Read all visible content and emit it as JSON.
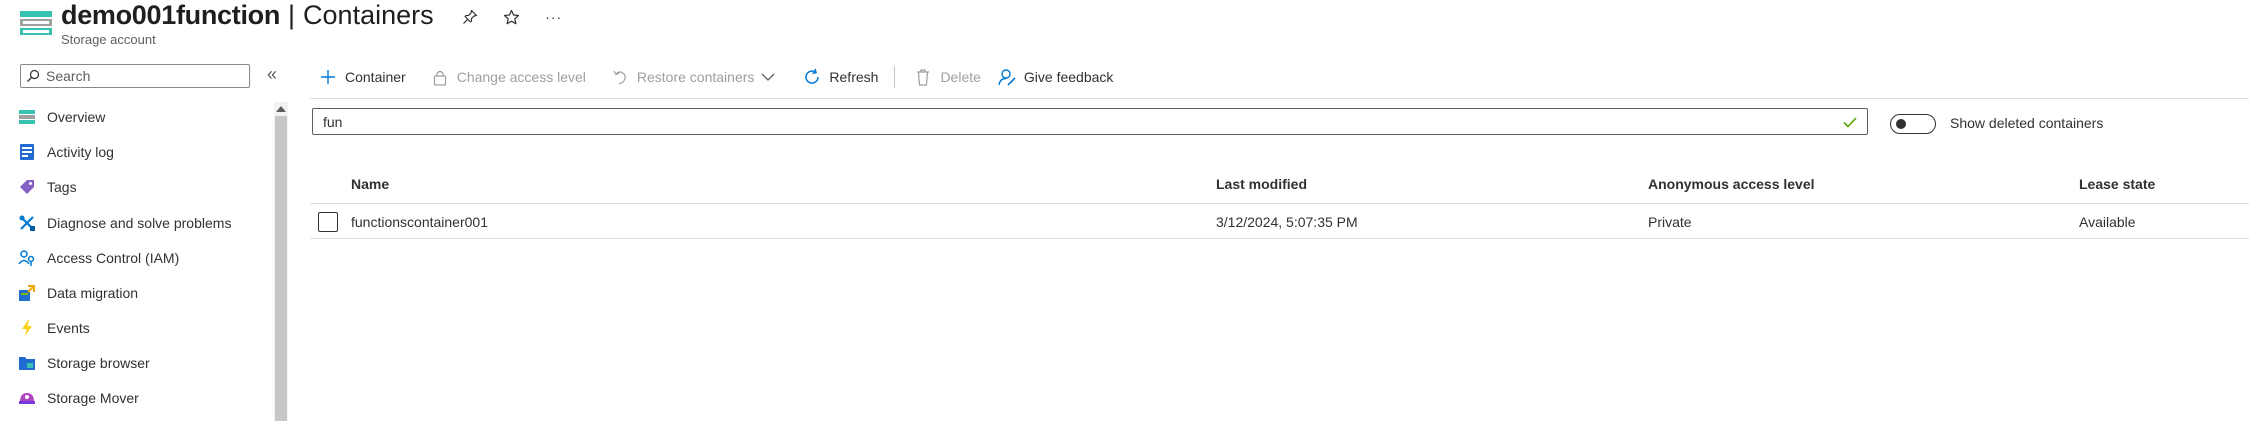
{
  "header": {
    "resource_name": "demo001function",
    "separator": "|",
    "page_title": "Containers",
    "subtitle": "Storage account",
    "more_label": "···"
  },
  "sidebar": {
    "search_placeholder": "Search",
    "collapse_label": "«",
    "items": [
      {
        "label": "Overview",
        "icon": "storage-overview-icon"
      },
      {
        "label": "Activity log",
        "icon": "activity-log-icon"
      },
      {
        "label": "Tags",
        "icon": "tag-icon"
      },
      {
        "label": "Diagnose and solve problems",
        "icon": "diagnose-icon"
      },
      {
        "label": "Access Control (IAM)",
        "icon": "access-control-icon"
      },
      {
        "label": "Data migration",
        "icon": "data-migration-icon"
      },
      {
        "label": "Events",
        "icon": "lightning-icon"
      },
      {
        "label": "Storage browser",
        "icon": "storage-browser-icon"
      },
      {
        "label": "Storage Mover",
        "icon": "storage-mover-icon"
      }
    ]
  },
  "toolbar": {
    "container_label": "Container",
    "change_access_label": "Change access level",
    "restore_label": "Restore containers",
    "refresh_label": "Refresh",
    "delete_label": "Delete",
    "feedback_label": "Give feedback"
  },
  "filter": {
    "value": "fun",
    "toggle_label": "Show deleted containers",
    "toggle_on": false
  },
  "table": {
    "columns": [
      "Name",
      "Last modified",
      "Anonymous access level",
      "Lease state"
    ],
    "rows": [
      {
        "name": "functionscontainer001",
        "last_modified": "3/12/2024, 5:07:35 PM",
        "access_level": "Private",
        "lease_state": "Available"
      }
    ]
  },
  "colors": {
    "accent": "#0078d4",
    "disabled_text": "#a19f9d",
    "success": "#57a300"
  }
}
